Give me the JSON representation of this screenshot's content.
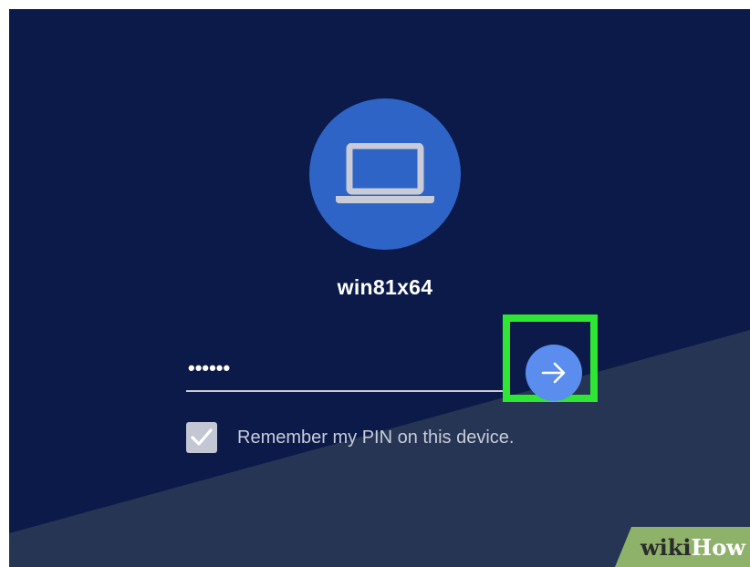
{
  "account": {
    "username": "win81x64",
    "avatar_icon": "laptop-icon"
  },
  "pin": {
    "masked_value": "••••••",
    "submit_icon": "arrow-right-icon"
  },
  "remember": {
    "label": "Remember my PIN on this device.",
    "checked": true
  },
  "watermark": {
    "part1": "wiki",
    "part2": "How"
  },
  "colors": {
    "background": "#0c1a4a",
    "avatar": "#2f64c7",
    "submit_button": "#5b8def",
    "highlight": "#2ee633"
  }
}
